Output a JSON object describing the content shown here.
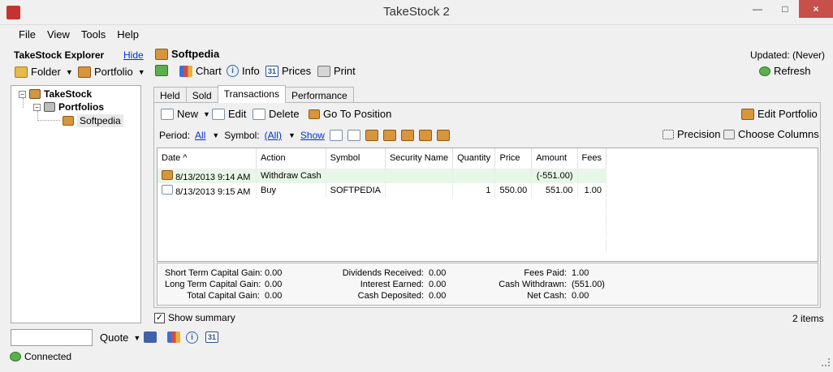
{
  "window": {
    "title": "TakeStock 2",
    "app_icon": "takestock-app-icon"
  },
  "menu": [
    "File",
    "View",
    "Tools",
    "Help"
  ],
  "explorer": {
    "title": "TakeStock Explorer",
    "hide_label": "Hide",
    "folder_label": "Folder",
    "portfolio_label": "Portfolio",
    "tree": {
      "root": "TakeStock",
      "child": "Portfolios",
      "leaf": "Softpedia"
    }
  },
  "portfolio": {
    "name": "Softpedia",
    "updated": "Updated: (Never)",
    "refresh_label": "Refresh",
    "chart_label": "Chart",
    "info_label": "Info",
    "prices_label": "Prices",
    "print_label": "Print"
  },
  "tabs": [
    "Held",
    "Sold",
    "Transactions",
    "Performance"
  ],
  "actions": {
    "new_label": "New",
    "edit_label": "Edit",
    "delete_label": "Delete",
    "goto_label": "Go To Position",
    "edit_portfolio_label": "Edit Portfolio"
  },
  "filters": {
    "period_label": "Period:",
    "period_value": "All",
    "symbol_label": "Symbol:",
    "symbol_value": "(All)",
    "show_label": "Show",
    "precision_label": "Precision",
    "choose_columns_label": "Choose Columns"
  },
  "table": {
    "columns": [
      "Date ^",
      "Action",
      "Symbol",
      "Security Name",
      "Quantity",
      "Price",
      "Amount",
      "Fees"
    ],
    "rows": [
      [
        "8/13/2013  9:14 AM",
        "Withdraw Cash",
        "",
        "",
        "",
        "",
        "(-551.00)",
        ""
      ],
      [
        "8/13/2013  9:15 AM",
        "Buy",
        "SOFTPEDIA",
        "",
        "1",
        "550.00",
        "551.00",
        "1.00"
      ]
    ]
  },
  "summary": {
    "left": [
      [
        "Short Term Capital Gain:",
        "0.00"
      ],
      [
        "Long Term Capital Gain:",
        "0.00"
      ],
      [
        "Total Capital Gain:",
        "0.00"
      ]
    ],
    "middle": [
      [
        "Dividends Received:",
        "0.00"
      ],
      [
        "Interest Earned:",
        "0.00"
      ],
      [
        "Cash Deposited:",
        "0.00"
      ]
    ],
    "right": [
      [
        "Fees Paid:",
        "1.00"
      ],
      [
        "Cash Withdrawn:",
        "(551.00)"
      ],
      [
        "Net Cash:",
        "0.00"
      ]
    ]
  },
  "bottom": {
    "show_summary_label": "Show summary",
    "items_count": "2 items",
    "quote_label": "Quote",
    "status": "Connected"
  },
  "colors": {
    "link": "#0033cc",
    "selected_row": "#e7f7e7",
    "close_button": "#c7504a"
  }
}
